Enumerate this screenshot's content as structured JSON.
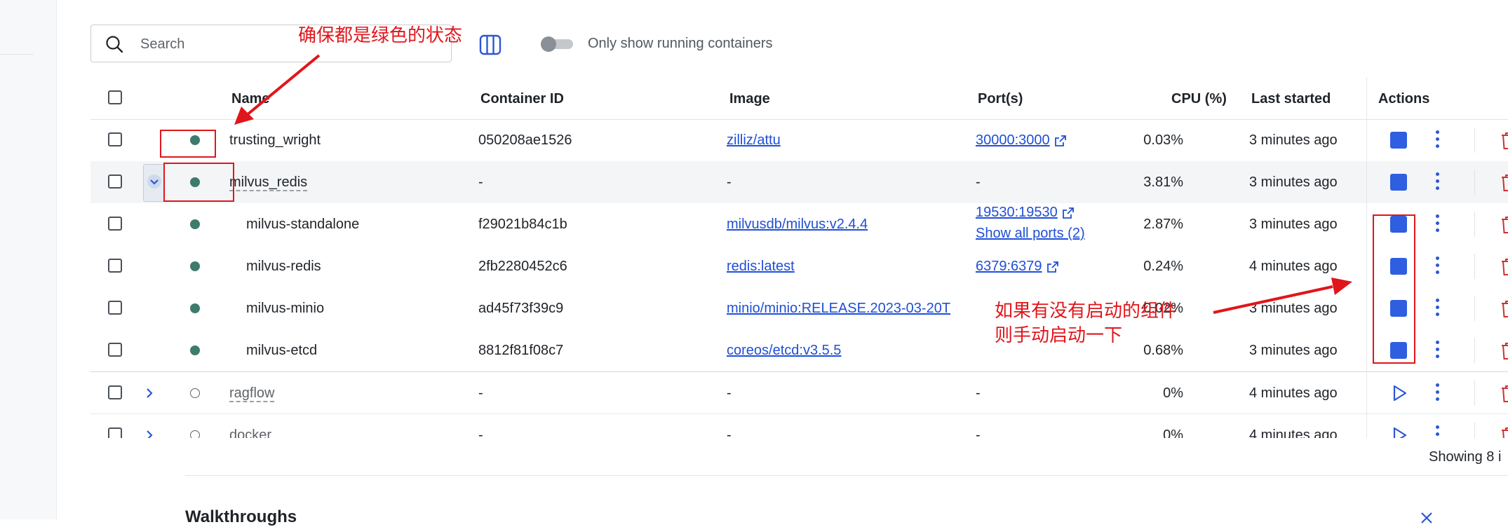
{
  "search": {
    "placeholder": "Search"
  },
  "toolbar": {
    "toggle_label": "Only show running containers"
  },
  "table": {
    "headers": {
      "name": "Name",
      "container_id": "Container ID",
      "image": "Image",
      "ports": "Port(s)",
      "cpu": "CPU (%)",
      "last_started": "Last started",
      "actions": "Actions"
    },
    "rows": [
      {
        "name": "trusting_wright",
        "id": "050208ae1526",
        "image": "zilliz/attu",
        "port": "30000:3000",
        "port2": "",
        "cpu": "0.03%",
        "started": "3 minutes ago",
        "status": "running"
      },
      {
        "name": "milvus_redis",
        "id": "-",
        "image": "-",
        "port": "-",
        "port2": "",
        "cpu": "3.81%",
        "started": "3 minutes ago",
        "status": "running"
      },
      {
        "name": "milvus-standalone",
        "id": "f29021b84c1b",
        "image": "milvusdb/milvus:v2.4.4",
        "port": "19530:19530",
        "port2": "Show all ports (2)",
        "cpu": "2.87%",
        "started": "3 minutes ago",
        "status": "running"
      },
      {
        "name": "milvus-redis",
        "id": "2fb2280452c6",
        "image": "redis:latest",
        "port": "6379:6379",
        "port2": "",
        "cpu": "0.24%",
        "started": "4 minutes ago",
        "status": "running"
      },
      {
        "name": "milvus-minio",
        "id": "ad45f73f39c9",
        "image": "minio/minio:RELEASE.2023-03-20T",
        "port": "",
        "port2": "",
        "cpu": "0.02%",
        "started": "3 minutes ago",
        "status": "running"
      },
      {
        "name": "milvus-etcd",
        "id": "8812f81f08c7",
        "image": "coreos/etcd:v3.5.5",
        "port": "",
        "port2": "",
        "cpu": "0.68%",
        "started": "3 minutes ago",
        "status": "running"
      },
      {
        "name": "ragflow",
        "id": "-",
        "image": "-",
        "port": "-",
        "port2": "",
        "cpu": "0%",
        "started": "4 minutes ago",
        "status": "stopped"
      },
      {
        "name": "docker",
        "id": "-",
        "image": "-",
        "port": "-",
        "port2": "",
        "cpu": "0%",
        "started": "4 minutes ago",
        "status": "stopped"
      }
    ]
  },
  "footer": {
    "showing": "Showing 8 i",
    "walkthrough_title": "Walkthroughs"
  },
  "annotations": {
    "top": "确保都是绿色的状态",
    "right_line1": "如果有没有启动的组件",
    "right_line2": "则手动启动一下",
    "color": "#e0161b"
  },
  "colors": {
    "accent": "#2f5fe0",
    "running": "#3e7b6c",
    "delete": "#d32f2f"
  }
}
